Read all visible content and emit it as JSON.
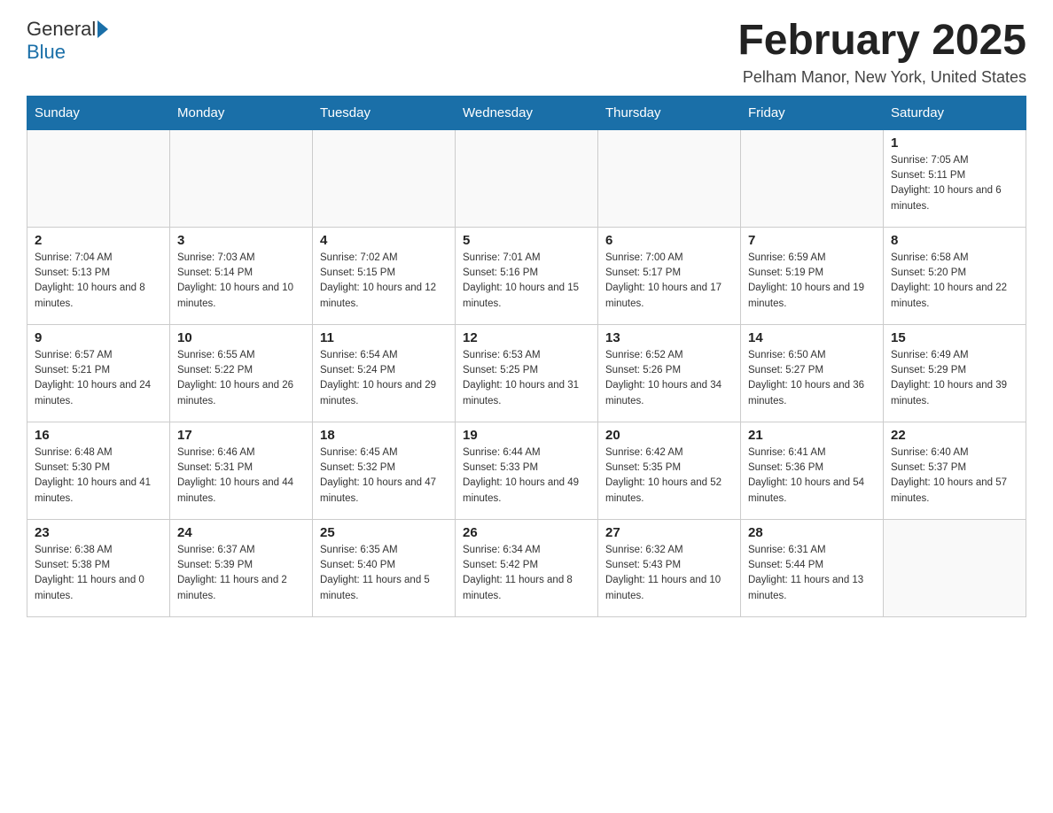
{
  "header": {
    "logo_general": "General",
    "logo_blue": "Blue",
    "month_title": "February 2025",
    "subtitle": "Pelham Manor, New York, United States"
  },
  "weekdays": [
    "Sunday",
    "Monday",
    "Tuesday",
    "Wednesday",
    "Thursday",
    "Friday",
    "Saturday"
  ],
  "weeks": [
    [
      {
        "day": "",
        "sunrise": "",
        "sunset": "",
        "daylight": ""
      },
      {
        "day": "",
        "sunrise": "",
        "sunset": "",
        "daylight": ""
      },
      {
        "day": "",
        "sunrise": "",
        "sunset": "",
        "daylight": ""
      },
      {
        "day": "",
        "sunrise": "",
        "sunset": "",
        "daylight": ""
      },
      {
        "day": "",
        "sunrise": "",
        "sunset": "",
        "daylight": ""
      },
      {
        "day": "",
        "sunrise": "",
        "sunset": "",
        "daylight": ""
      },
      {
        "day": "1",
        "sunrise": "Sunrise: 7:05 AM",
        "sunset": "Sunset: 5:11 PM",
        "daylight": "Daylight: 10 hours and 6 minutes."
      }
    ],
    [
      {
        "day": "2",
        "sunrise": "Sunrise: 7:04 AM",
        "sunset": "Sunset: 5:13 PM",
        "daylight": "Daylight: 10 hours and 8 minutes."
      },
      {
        "day": "3",
        "sunrise": "Sunrise: 7:03 AM",
        "sunset": "Sunset: 5:14 PM",
        "daylight": "Daylight: 10 hours and 10 minutes."
      },
      {
        "day": "4",
        "sunrise": "Sunrise: 7:02 AM",
        "sunset": "Sunset: 5:15 PM",
        "daylight": "Daylight: 10 hours and 12 minutes."
      },
      {
        "day": "5",
        "sunrise": "Sunrise: 7:01 AM",
        "sunset": "Sunset: 5:16 PM",
        "daylight": "Daylight: 10 hours and 15 minutes."
      },
      {
        "day": "6",
        "sunrise": "Sunrise: 7:00 AM",
        "sunset": "Sunset: 5:17 PM",
        "daylight": "Daylight: 10 hours and 17 minutes."
      },
      {
        "day": "7",
        "sunrise": "Sunrise: 6:59 AM",
        "sunset": "Sunset: 5:19 PM",
        "daylight": "Daylight: 10 hours and 19 minutes."
      },
      {
        "day": "8",
        "sunrise": "Sunrise: 6:58 AM",
        "sunset": "Sunset: 5:20 PM",
        "daylight": "Daylight: 10 hours and 22 minutes."
      }
    ],
    [
      {
        "day": "9",
        "sunrise": "Sunrise: 6:57 AM",
        "sunset": "Sunset: 5:21 PM",
        "daylight": "Daylight: 10 hours and 24 minutes."
      },
      {
        "day": "10",
        "sunrise": "Sunrise: 6:55 AM",
        "sunset": "Sunset: 5:22 PM",
        "daylight": "Daylight: 10 hours and 26 minutes."
      },
      {
        "day": "11",
        "sunrise": "Sunrise: 6:54 AM",
        "sunset": "Sunset: 5:24 PM",
        "daylight": "Daylight: 10 hours and 29 minutes."
      },
      {
        "day": "12",
        "sunrise": "Sunrise: 6:53 AM",
        "sunset": "Sunset: 5:25 PM",
        "daylight": "Daylight: 10 hours and 31 minutes."
      },
      {
        "day": "13",
        "sunrise": "Sunrise: 6:52 AM",
        "sunset": "Sunset: 5:26 PM",
        "daylight": "Daylight: 10 hours and 34 minutes."
      },
      {
        "day": "14",
        "sunrise": "Sunrise: 6:50 AM",
        "sunset": "Sunset: 5:27 PM",
        "daylight": "Daylight: 10 hours and 36 minutes."
      },
      {
        "day": "15",
        "sunrise": "Sunrise: 6:49 AM",
        "sunset": "Sunset: 5:29 PM",
        "daylight": "Daylight: 10 hours and 39 minutes."
      }
    ],
    [
      {
        "day": "16",
        "sunrise": "Sunrise: 6:48 AM",
        "sunset": "Sunset: 5:30 PM",
        "daylight": "Daylight: 10 hours and 41 minutes."
      },
      {
        "day": "17",
        "sunrise": "Sunrise: 6:46 AM",
        "sunset": "Sunset: 5:31 PM",
        "daylight": "Daylight: 10 hours and 44 minutes."
      },
      {
        "day": "18",
        "sunrise": "Sunrise: 6:45 AM",
        "sunset": "Sunset: 5:32 PM",
        "daylight": "Daylight: 10 hours and 47 minutes."
      },
      {
        "day": "19",
        "sunrise": "Sunrise: 6:44 AM",
        "sunset": "Sunset: 5:33 PM",
        "daylight": "Daylight: 10 hours and 49 minutes."
      },
      {
        "day": "20",
        "sunrise": "Sunrise: 6:42 AM",
        "sunset": "Sunset: 5:35 PM",
        "daylight": "Daylight: 10 hours and 52 minutes."
      },
      {
        "day": "21",
        "sunrise": "Sunrise: 6:41 AM",
        "sunset": "Sunset: 5:36 PM",
        "daylight": "Daylight: 10 hours and 54 minutes."
      },
      {
        "day": "22",
        "sunrise": "Sunrise: 6:40 AM",
        "sunset": "Sunset: 5:37 PM",
        "daylight": "Daylight: 10 hours and 57 minutes."
      }
    ],
    [
      {
        "day": "23",
        "sunrise": "Sunrise: 6:38 AM",
        "sunset": "Sunset: 5:38 PM",
        "daylight": "Daylight: 11 hours and 0 minutes."
      },
      {
        "day": "24",
        "sunrise": "Sunrise: 6:37 AM",
        "sunset": "Sunset: 5:39 PM",
        "daylight": "Daylight: 11 hours and 2 minutes."
      },
      {
        "day": "25",
        "sunrise": "Sunrise: 6:35 AM",
        "sunset": "Sunset: 5:40 PM",
        "daylight": "Daylight: 11 hours and 5 minutes."
      },
      {
        "day": "26",
        "sunrise": "Sunrise: 6:34 AM",
        "sunset": "Sunset: 5:42 PM",
        "daylight": "Daylight: 11 hours and 8 minutes."
      },
      {
        "day": "27",
        "sunrise": "Sunrise: 6:32 AM",
        "sunset": "Sunset: 5:43 PM",
        "daylight": "Daylight: 11 hours and 10 minutes."
      },
      {
        "day": "28",
        "sunrise": "Sunrise: 6:31 AM",
        "sunset": "Sunset: 5:44 PM",
        "daylight": "Daylight: 11 hours and 13 minutes."
      },
      {
        "day": "",
        "sunrise": "",
        "sunset": "",
        "daylight": ""
      }
    ]
  ]
}
